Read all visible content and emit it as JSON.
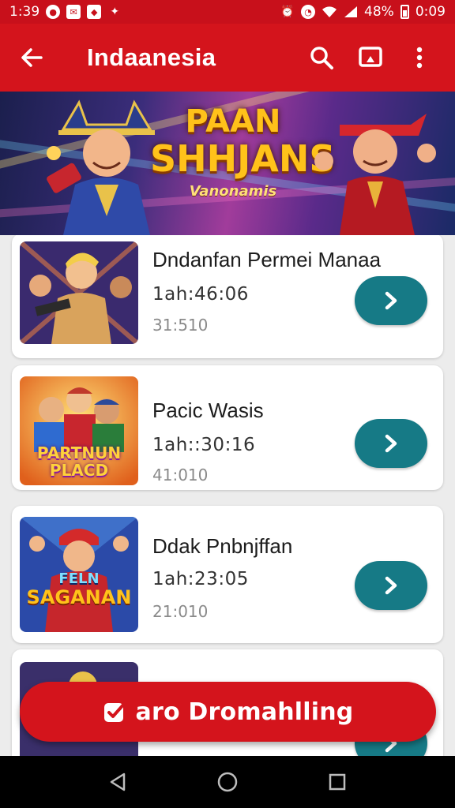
{
  "status_bar": {
    "time": "1:39",
    "notification_icons": [
      "circle-icon",
      "mail-icon",
      "shield-icon",
      "bolt-icon"
    ],
    "system_icons": [
      "alarm-icon",
      "timer-icon",
      "wifi-icon",
      "signal-icon"
    ],
    "battery": "48%",
    "clock_right": "0:09"
  },
  "app_bar": {
    "title": "Indaanesia",
    "back_icon": "arrow-left-icon",
    "actions": [
      "search-icon",
      "cast-icon",
      "more-vert-icon"
    ]
  },
  "banner": {
    "title_line1": "PAAN",
    "title_line2": "SHHJANS",
    "subtitle": "Vanonamis"
  },
  "episodes": [
    {
      "title": "Dndanfan Permei Manaa",
      "duration": "1ah:46:06",
      "subtitle": "31:510"
    },
    {
      "title": "Pacic Wasis",
      "duration": "1ah::30:16",
      "subtitle": "41:010"
    },
    {
      "title": "Ddak Pnbnjffan",
      "duration": "1ah:23:05",
      "subtitle": "21:010"
    },
    {
      "title": "",
      "duration": "",
      "subtitle": ""
    }
  ],
  "thumb_texts": {
    "thumb2": "PARTNUN PLACD",
    "thumb3_line1": "FELN",
    "thumb3_line2": "SAGANAN"
  },
  "download_button": {
    "label": "aro Dromahlling",
    "icon": "check-badge-icon"
  },
  "colors": {
    "primary_red": "#d4141c",
    "play_teal": "#167a86",
    "card_bg": "#ffffff",
    "page_bg": "#ececec"
  }
}
